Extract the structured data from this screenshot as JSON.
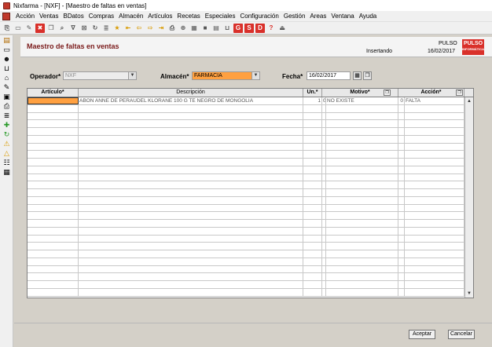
{
  "window": {
    "title": "Nixfarma - [NXF] - [Maestro de faltas en ventas]"
  },
  "menu": [
    "Acción",
    "Ventas",
    "BDatos",
    "Compras",
    "Almacén",
    "Artículos",
    "Recetas",
    "Especiales",
    "Configuración",
    "Gestión",
    "Areas",
    "Ventana",
    "Ayuda"
  ],
  "toolbar": {
    "letters": [
      "G",
      "S",
      "D",
      "?"
    ]
  },
  "header": {
    "form_title": "Maestro de faltas en ventas",
    "status": "Insertando",
    "user": "PULSO",
    "date": "16/02/2017",
    "logo_text": "PULSO",
    "logo_sub": "INFORMÁTICA"
  },
  "form": {
    "operador_label": "Operador*",
    "operador_value": "NXF",
    "almacen_label": "Almacén*",
    "almacen_value": "FARMACIA",
    "fecha_label": "Fecha*",
    "fecha_value": "16/02/2017"
  },
  "grid": {
    "columns": {
      "articulo": "Artículo*",
      "descripcion": "Descripción",
      "unidades": "Un.*",
      "motivo": "Motivo*",
      "accion": "Acción*"
    },
    "rows": [
      {
        "articulo": "",
        "descripcion": "ABON ANNE DE PERAUDEL KLORANE 100 G TE NEGRO DE MONGOLIA",
        "unidades": "1",
        "motivo_code": "0",
        "motivo": "NO EXISTE",
        "accion_code": "0",
        "accion": "FALTA"
      }
    ]
  },
  "buttons": {
    "aceptar": "Aceptar",
    "cancelar": "Cancelar"
  },
  "colors": {
    "accent": "#7a1a1a",
    "active_field": "#ffa040",
    "logo": "#d9302a"
  }
}
